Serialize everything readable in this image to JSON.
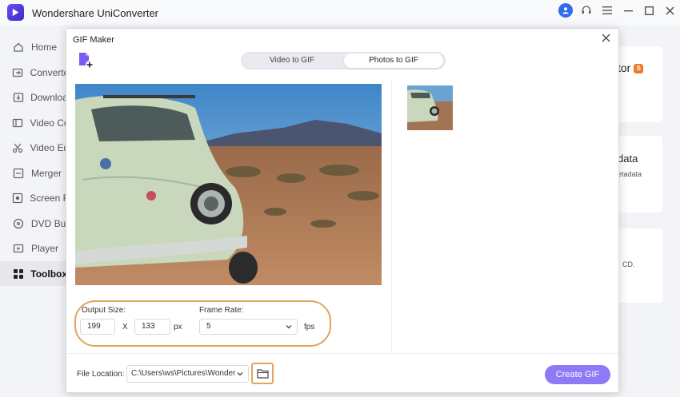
{
  "app": {
    "title": "Wondershare UniConverter"
  },
  "sidebar": {
    "items": [
      {
        "label": "Home",
        "icon": "home-icon",
        "active": false
      },
      {
        "label": "Converte",
        "icon": "convert-icon",
        "active": false
      },
      {
        "label": "Downloa",
        "icon": "download-icon",
        "active": false
      },
      {
        "label": "Video Co",
        "icon": "video-compress-icon",
        "active": false
      },
      {
        "label": "Video Ed",
        "icon": "video-edit-icon",
        "active": false
      },
      {
        "label": "Merger",
        "icon": "merger-icon",
        "active": false
      },
      {
        "label": "Screen R",
        "icon": "screen-record-icon",
        "active": false
      },
      {
        "label": "DVD Bu",
        "icon": "dvd-icon",
        "active": false
      },
      {
        "label": "Player",
        "icon": "player-icon",
        "active": false
      },
      {
        "label": "Toolbox",
        "icon": "toolbox-icon",
        "active": true
      }
    ]
  },
  "background": {
    "card1_text": "tor",
    "card2_title": "data",
    "card2_sub": "etadata",
    "card3_text": "CD."
  },
  "dialog": {
    "title": "GIF Maker",
    "tabs": [
      {
        "label": "Video to GIF",
        "active": false
      },
      {
        "label": "Photos to GIF",
        "active": true
      }
    ],
    "output_size_label": "Output Size:",
    "width": "199",
    "times": "X",
    "height": "133",
    "px_label": "px",
    "frame_rate_label": "Frame Rate:",
    "frame_rate": "5",
    "fps_label": "fps",
    "file_location_label": "File Location:",
    "file_location": "C:\\Users\\ws\\Pictures\\Wonders",
    "create_button": "Create GIF"
  },
  "colors": {
    "accent": "#8f7af5",
    "highlight": "#e2a35a",
    "user_badge": "#2f6cf0",
    "brand_badge": "#f07a2c"
  }
}
